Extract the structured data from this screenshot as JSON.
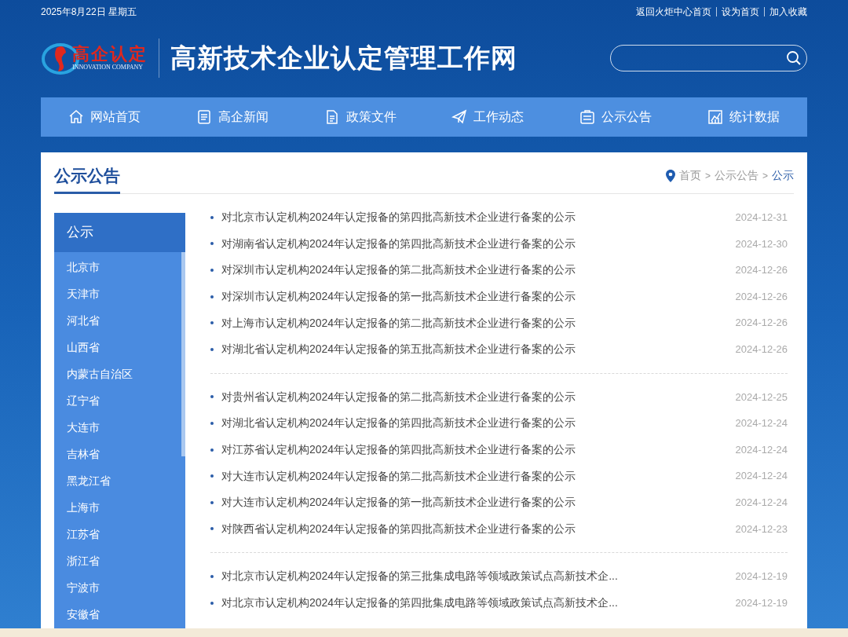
{
  "top_bar": {
    "date": "2025年8月22日 星期五",
    "links": [
      "返回火炬中心首页",
      "设为首页",
      "加入收藏"
    ]
  },
  "header": {
    "logo_text": "高企认定",
    "logo_subtext": "INNOVATION COMPANY",
    "site_title": "高新技术企业认定管理工作网"
  },
  "nav": [
    {
      "label": "网站首页",
      "kind": "home",
      "selected": false
    },
    {
      "label": "高企新闻",
      "kind": "news",
      "selected": false
    },
    {
      "label": "政策文件",
      "kind": "doc",
      "selected": false
    },
    {
      "label": "工作动态",
      "kind": "send",
      "selected": false
    },
    {
      "label": "公示公告",
      "kind": "notice",
      "selected": false
    },
    {
      "label": "统计数据",
      "kind": "chart",
      "selected": false
    }
  ],
  "section_title": "公示公告",
  "breadcrumb": [
    "首页",
    "公示公告",
    "公示"
  ],
  "breadcrumb_separator": ">",
  "sidebar": {
    "title": "公示",
    "items": [
      "北京市",
      "天津市",
      "河北省",
      "山西省",
      "内蒙古自治区",
      "辽宁省",
      "大连市",
      "吉林省",
      "黑龙江省",
      "上海市",
      "江苏省",
      "浙江省",
      "宁波市",
      "安徽省"
    ]
  },
  "groups": [
    {
      "items": [
        {
          "title": "对北京市认定机构2024年认定报备的第四批高新技术企业进行备案的公示",
          "date": "2024-12-31"
        },
        {
          "title": "对湖南省认定机构2024年认定报备的第四批高新技术企业进行备案的公示",
          "date": "2024-12-30"
        },
        {
          "title": "对深圳市认定机构2024年认定报备的第二批高新技术企业进行备案的公示",
          "date": "2024-12-26"
        },
        {
          "title": "对深圳市认定机构2024年认定报备的第一批高新技术企业进行备案的公示",
          "date": "2024-12-26"
        },
        {
          "title": "对上海市认定机构2024年认定报备的第二批高新技术企业进行备案的公示",
          "date": "2024-12-26"
        },
        {
          "title": "对湖北省认定机构2024年认定报备的第五批高新技术企业进行备案的公示",
          "date": "2024-12-26"
        }
      ]
    },
    {
      "items": [
        {
          "title": "对贵州省认定机构2024年认定报备的第二批高新技术企业进行备案的公示",
          "date": "2024-12-25"
        },
        {
          "title": "对湖北省认定机构2024年认定报备的第四批高新技术企业进行备案的公示",
          "date": "2024-12-24"
        },
        {
          "title": "对江苏省认定机构2024年认定报备的第四批高新技术企业进行备案的公示",
          "date": "2024-12-24"
        },
        {
          "title": "对大连市认定机构2024年认定报备的第二批高新技术企业进行备案的公示",
          "date": "2024-12-24"
        },
        {
          "title": "对大连市认定机构2024年认定报备的第一批高新技术企业进行备案的公示",
          "date": "2024-12-24"
        },
        {
          "title": "对陕西省认定机构2024年认定报备的第四批高新技术企业进行备案的公示",
          "date": "2024-12-23"
        }
      ]
    },
    {
      "items": [
        {
          "title": "对北京市认定机构2024年认定报备的第三批集成电路等领域政策试点高新技术企...",
          "date": "2024-12-19"
        },
        {
          "title": "对北京市认定机构2024年认定报备的第四批集成电路等领域政策试点高新技术企...",
          "date": "2024-12-19"
        }
      ]
    }
  ]
}
